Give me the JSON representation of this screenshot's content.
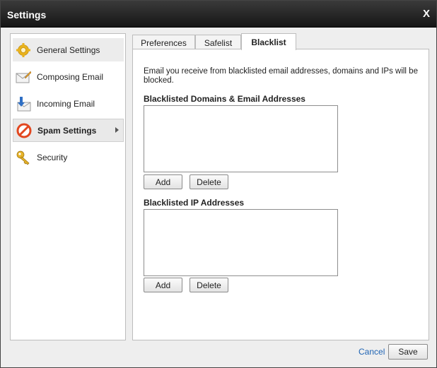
{
  "window": {
    "title": "Settings",
    "close_label": "X"
  },
  "sidebar": {
    "items": [
      {
        "label": "General Settings",
        "icon": "gear-icon"
      },
      {
        "label": "Composing Email",
        "icon": "compose-icon"
      },
      {
        "label": "Incoming Email",
        "icon": "incoming-mail-icon"
      },
      {
        "label": "Spam Settings",
        "icon": "no-spam-icon",
        "selected": true
      },
      {
        "label": "Security",
        "icon": "key-icon"
      }
    ]
  },
  "tabs": [
    {
      "label": "Preferences"
    },
    {
      "label": "Safelist"
    },
    {
      "label": "Blacklist",
      "selected": true
    }
  ],
  "blacklist": {
    "description": "Email you receive from blacklisted email addresses, domains and IPs will be blocked.",
    "domains_label": "Blacklisted Domains & Email Addresses",
    "ip_label": "Blacklisted IP Addresses",
    "add_label": "Add",
    "delete_label": "Delete"
  },
  "footer": {
    "cancel_label": "Cancel",
    "save_label": "Save"
  },
  "colors": {
    "titlebar": "#1e1e1e",
    "link": "#1f64b4",
    "spam_icon": "#e2471f"
  }
}
